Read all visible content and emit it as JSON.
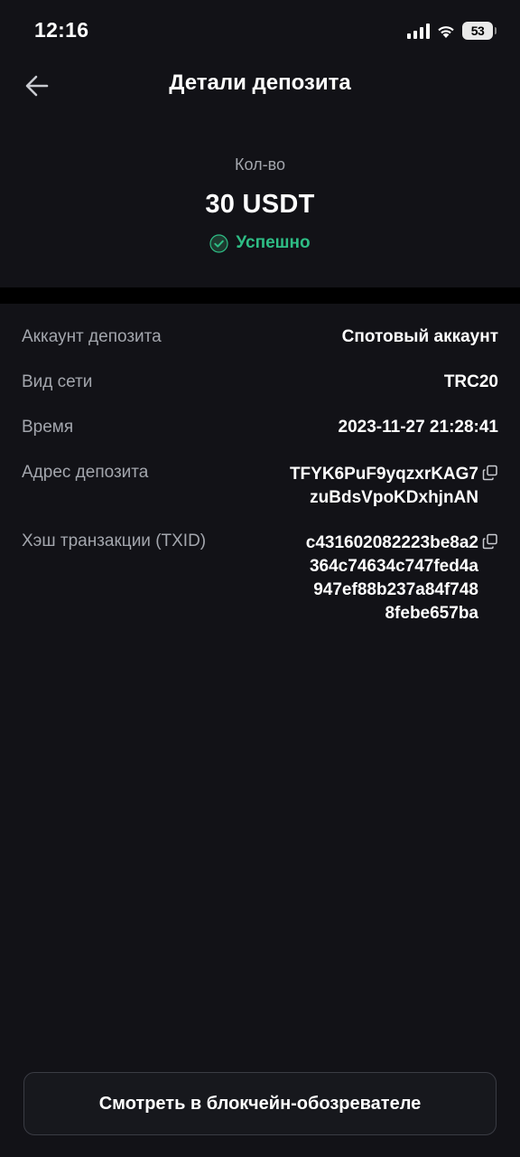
{
  "status_bar": {
    "time": "12:16",
    "battery": "53",
    "icons": [
      "cellular-signal-icon",
      "wifi-icon",
      "battery-icon"
    ]
  },
  "header": {
    "back_icon": "arrow-left-icon",
    "title": "Детали депозита"
  },
  "summary": {
    "amount_label": "Кол-во",
    "amount": "30 USDT",
    "status_icon": "check-circle-icon",
    "status": "Успешно",
    "status_color": "#2ebd85"
  },
  "details": {
    "account_label": "Аккаунт депозита",
    "account_value": "Спотовый аккаунт",
    "network_label": "Вид сети",
    "network_value": "TRC20",
    "time_label": "Время",
    "time_value": "2023-11-27 21:28:41",
    "address_label": "Адрес депозита",
    "address_lines": [
      "TFYK6PuF9yqzxrKAG7",
      "zuBdsVpoKDxhjnAN"
    ],
    "txid_label": "Хэш транзакции (TXID)",
    "txid_lines": [
      "c431602082223be8a2",
      "364c74634c747fed4a",
      "947ef88b237a84f748",
      "8febe657ba"
    ]
  },
  "footer": {
    "explorer_button": "Смотреть в блокчейн-обозревателе"
  },
  "colors": {
    "background": "#121217",
    "label": "#a3a6ad",
    "success": "#2ebd85"
  }
}
